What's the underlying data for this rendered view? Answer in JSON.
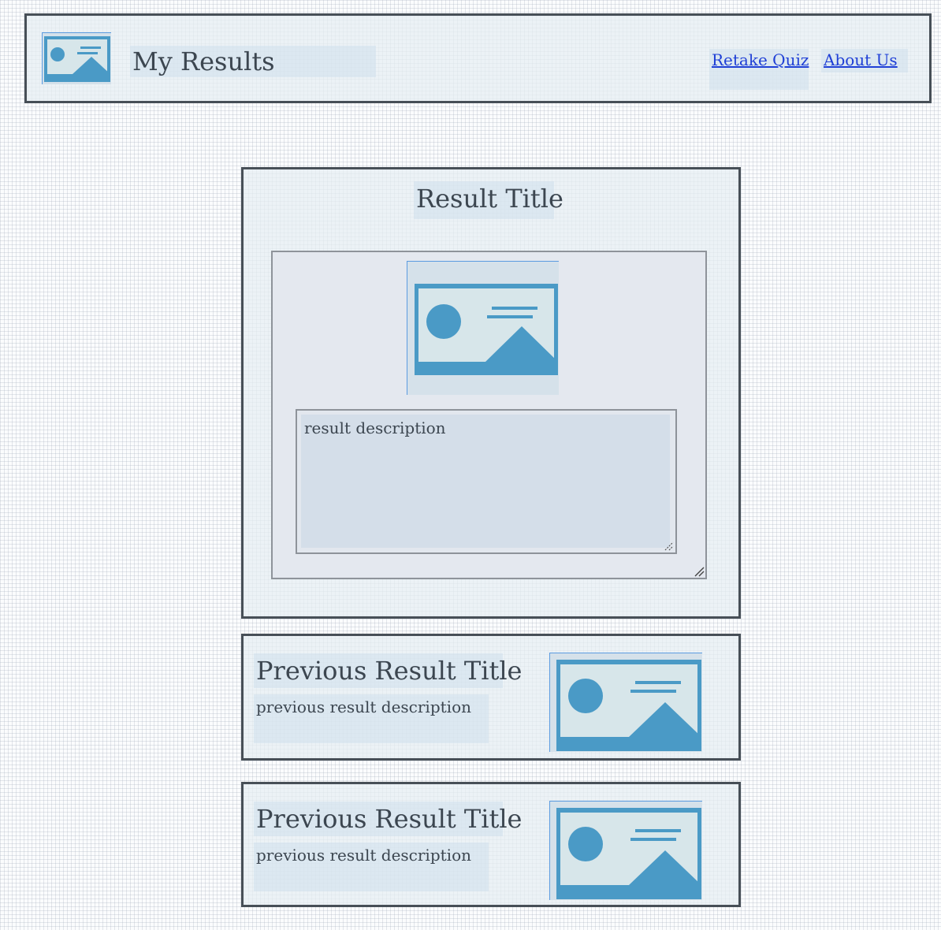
{
  "header": {
    "logo_icon": "image-placeholder-icon",
    "title": "My Results",
    "nav": [
      {
        "label": "Retake Quiz"
      },
      {
        "label": "About Us"
      }
    ]
  },
  "current_result": {
    "title": "Result Title",
    "image_icon": "image-placeholder-icon",
    "description_value": "result description"
  },
  "previous_results": [
    {
      "title": "Previous Result Title",
      "description": "previous result description",
      "image_icon": "image-placeholder-icon"
    },
    {
      "title": "Previous Result Title",
      "description": "previous result description",
      "image_icon": "image-placeholder-icon"
    }
  ],
  "colors": {
    "border": "#474f57",
    "image_accent": "#4a9ac6",
    "link": "#1f3fd6"
  }
}
